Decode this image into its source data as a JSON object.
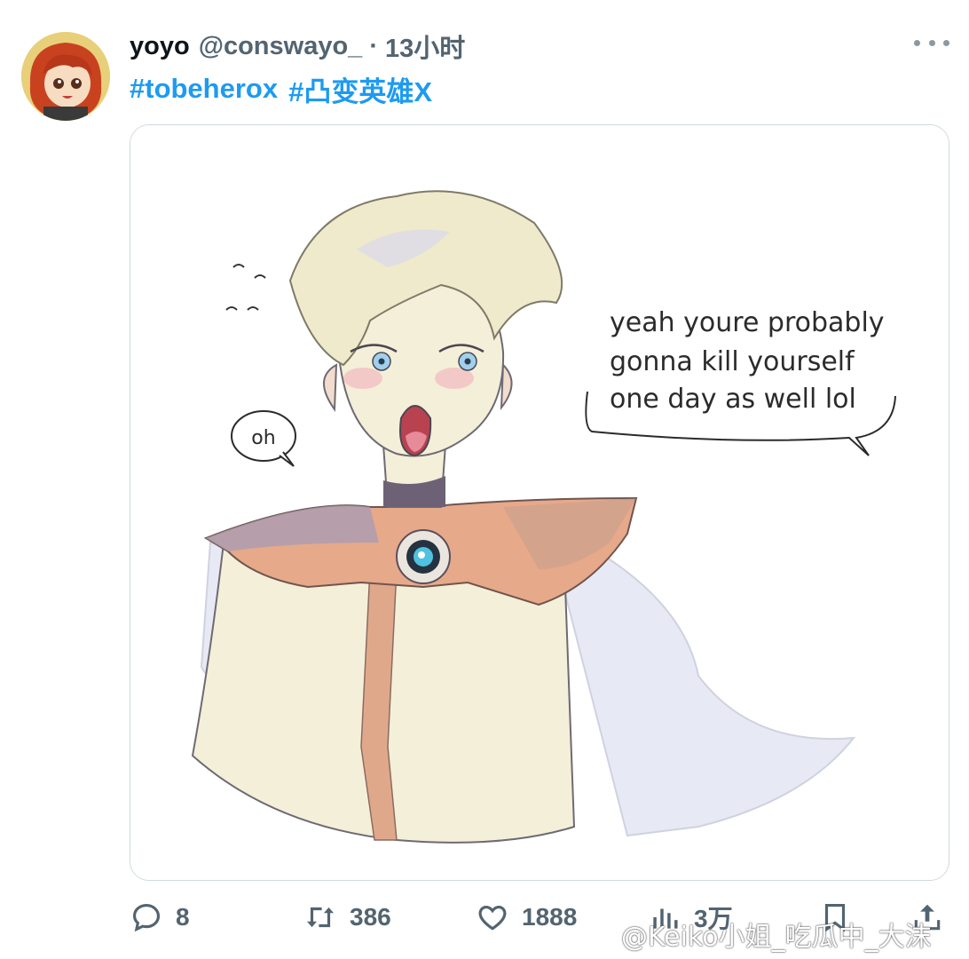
{
  "tweet": {
    "author_name": "yoyo",
    "handle": "@conswayo_",
    "separator": "·",
    "time": "13小时",
    "hashtags": [
      "#tobeherox",
      "#凸变英雄X"
    ]
  },
  "media": {
    "small_bubble": "oh",
    "speech_lines": [
      "yeah youre probably",
      "gonna kill yourself",
      "one day as well lol"
    ]
  },
  "actions": {
    "replies": "8",
    "retweets": "386",
    "likes": "1888",
    "views": "3万"
  },
  "watermark": "@Keiko小姐_吃瓜中_大沫",
  "colors": {
    "link": "#1d9bf0",
    "muted": "#536471",
    "border": "#cfd9de"
  }
}
